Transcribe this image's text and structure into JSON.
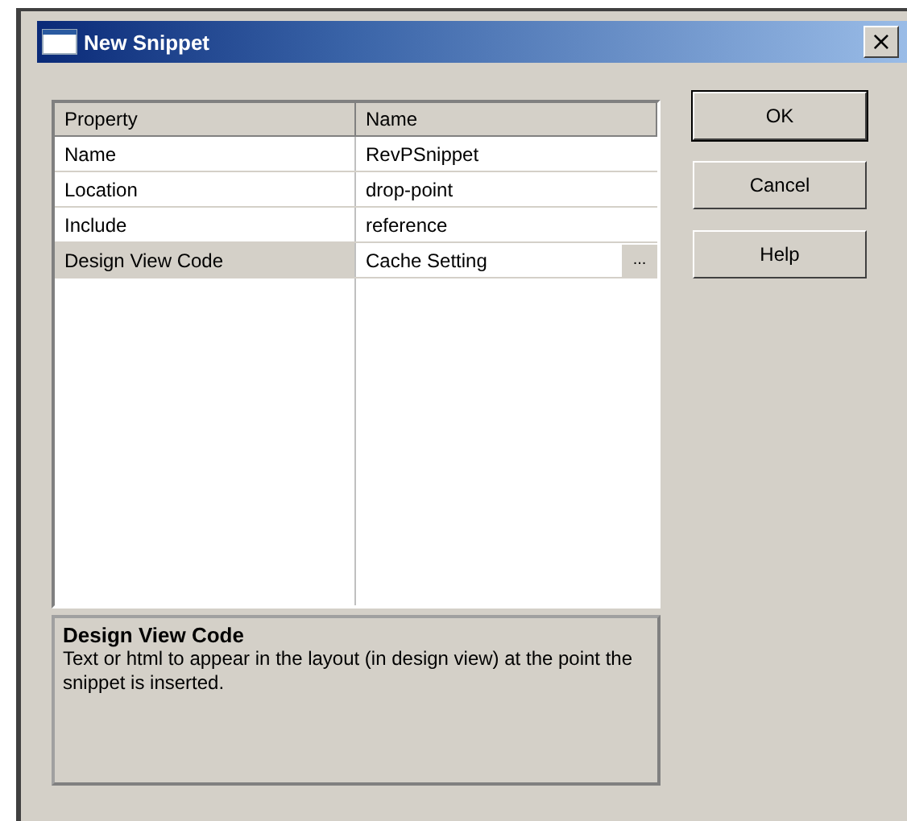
{
  "window": {
    "title": "New Snippet",
    "close": "×"
  },
  "grid": {
    "columns": [
      "Property",
      "Name"
    ],
    "rows": [
      {
        "property": "Name",
        "value": "RevPSnippet",
        "selected": false
      },
      {
        "property": "Location",
        "value": "drop-point",
        "selected": false
      },
      {
        "property": "Include",
        "value": "reference",
        "selected": false
      },
      {
        "property": "Design View Code",
        "value": "Cache Setting",
        "selected": true,
        "ellipsis": "..."
      }
    ]
  },
  "description": {
    "title": "Design View Code",
    "text": "Text or html to appear in the layout (in design view) at the point the snippet is inserted."
  },
  "buttons": [
    "OK",
    "Cancel",
    "Help"
  ]
}
